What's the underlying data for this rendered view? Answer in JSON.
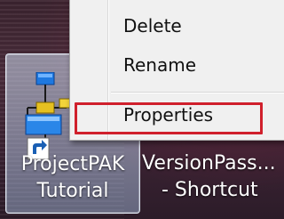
{
  "desktop": {
    "icons": [
      {
        "label_line1": "ProjectPAK",
        "label_line2": "Tutorial",
        "icon": "flowchart-shortcut-icon"
      },
      {
        "label_line1": "VersionPass...",
        "label_line2": "- Shortcut",
        "icon": "shortcut-icon"
      }
    ]
  },
  "context_menu": {
    "items": [
      {
        "label": "Delete"
      },
      {
        "label": "Rename"
      },
      {
        "label": "Properties"
      }
    ]
  },
  "colors": {
    "highlight": "#d0202c",
    "selection": "#bcd0ec",
    "menu_bg": "#f0f0f0"
  }
}
